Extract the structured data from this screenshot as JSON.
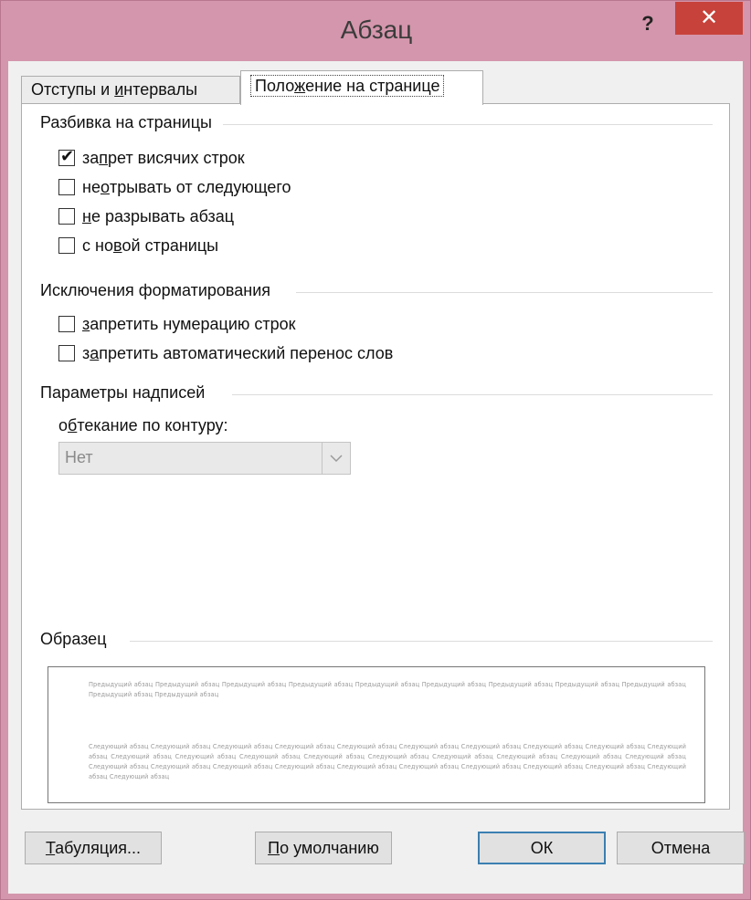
{
  "window": {
    "title": "Абзац",
    "help_label": "?",
    "close_label": "✕",
    "colors": {
      "frame": "#d496ac",
      "close": "#c7423a"
    }
  },
  "tabs": [
    {
      "label_pre": "Отступы и ",
      "label_u": "и",
      "label_post": "нтервалы"
    },
    {
      "label_pre": "Поло",
      "label_u": "ж",
      "label_post": "ение на странице"
    }
  ],
  "pagination": {
    "heading": "Разбивка на страницы",
    "options": [
      {
        "pre": "за",
        "u": "п",
        "post": "рет висячих строк",
        "checked": true
      },
      {
        "pre": "не ",
        "u": "о",
        "post": "трывать от следующего",
        "checked": false
      },
      {
        "pre": "",
        "u": "н",
        "post": "е разрывать абзац",
        "checked": false
      },
      {
        "pre": "с но",
        "u": "в",
        "post": "ой страницы",
        "checked": false
      }
    ]
  },
  "exceptions": {
    "heading": "Исключения форматирования",
    "options": [
      {
        "pre": "",
        "u": "з",
        "post": "апретить нумерацию строк",
        "checked": false
      },
      {
        "pre": "з",
        "u": "а",
        "post": "претить автоматический перенос слов",
        "checked": false
      }
    ]
  },
  "textbox": {
    "heading": "Параметры надписей",
    "wrap_label_pre": "о",
    "wrap_label_u": "б",
    "wrap_label_post": "текание по контуру:",
    "wrap_value": "Нет"
  },
  "preview": {
    "heading": "Образец",
    "previous_text": "Предыдущий абзац Предыдущий абзац Предыдущий абзац Предыдущий абзац Предыдущий абзац Предыдущий абзац Предыдущий абзац Предыдущий абзац Предыдущий абзац Предыдущий абзац Предыдущий абзац",
    "next_text": "Следующий абзац Следующий абзац Следующий абзац Следующий абзац Следующий абзац Следующий абзац Следующий абзац Следующий абзац Следующий абзац Следующий абзац Следующий абзац Следующий абзац Следующий абзац Следующий абзац Следующий абзац Следующий абзац Следующий абзац Следующий абзац Следующий абзац Следующий абзац Следующий абзац Следующий абзац Следующий абзац Следующий абзац Следующий абзац Следующий абзац Следующий абзац Следующий абзац Следующий абзац Следующий абзац"
  },
  "buttons": {
    "tabs": {
      "u": "Т",
      "post": "абуляция..."
    },
    "default": {
      "u": "П",
      "post": "о умолчанию"
    },
    "ok": "ОК",
    "cancel": "Отмена"
  }
}
